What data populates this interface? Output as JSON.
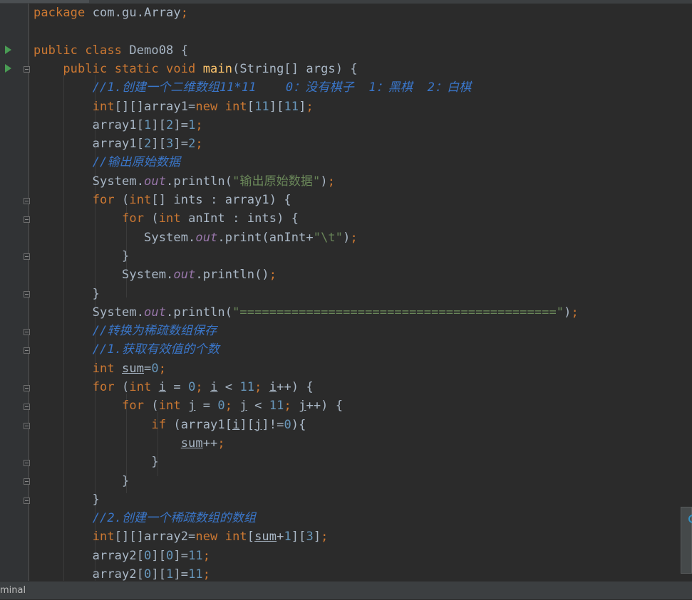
{
  "editor": {
    "lines": [
      [
        [
          "kw",
          "package "
        ],
        [
          "t",
          "com.gu.Array"
        ],
        [
          "kw",
          ";"
        ]
      ],
      [],
      [
        [
          "kw",
          "public class "
        ],
        [
          "t",
          "Demo08 {"
        ]
      ],
      [
        [
          "t",
          "    "
        ],
        [
          "kw",
          "public static void "
        ],
        [
          "fn",
          "main"
        ],
        [
          "t",
          "(String[] args) {"
        ]
      ],
      [
        [
          "t",
          "        "
        ],
        [
          "com",
          "//1.创建一个二维数组11*11    0：没有棋子  1：黑棋  2：白棋"
        ]
      ],
      [
        [
          "t",
          "        "
        ],
        [
          "kw",
          "int"
        ],
        [
          "t",
          "[][]array1="
        ],
        [
          "kw",
          "new int"
        ],
        [
          "t",
          "["
        ],
        [
          "num",
          "11"
        ],
        [
          "t",
          "]["
        ],
        [
          "num",
          "11"
        ],
        [
          "t",
          "]"
        ],
        [
          "kw",
          ";"
        ]
      ],
      [
        [
          "t",
          "        array1["
        ],
        [
          "num",
          "1"
        ],
        [
          "t",
          "]["
        ],
        [
          "num",
          "2"
        ],
        [
          "t",
          "]="
        ],
        [
          "num",
          "1"
        ],
        [
          "kw",
          ";"
        ]
      ],
      [
        [
          "t",
          "        array1["
        ],
        [
          "num",
          "2"
        ],
        [
          "t",
          "]["
        ],
        [
          "num",
          "3"
        ],
        [
          "t",
          "]="
        ],
        [
          "num",
          "2"
        ],
        [
          "kw",
          ";"
        ]
      ],
      [
        [
          "t",
          "        "
        ],
        [
          "com",
          "//输出原始数据"
        ]
      ],
      [
        [
          "t",
          "        System."
        ],
        [
          "fld",
          "out"
        ],
        [
          "t",
          ".println("
        ],
        [
          "str",
          "\"输出原始数据\""
        ],
        [
          "t",
          ")"
        ],
        [
          "kw",
          ";"
        ]
      ],
      [
        [
          "t",
          "        "
        ],
        [
          "kw",
          "for "
        ],
        [
          "t",
          "("
        ],
        [
          "kw",
          "int"
        ],
        [
          "t",
          "[] ints : array1) {"
        ]
      ],
      [
        [
          "t",
          "            "
        ],
        [
          "kw",
          "for "
        ],
        [
          "t",
          "("
        ],
        [
          "kw",
          "int "
        ],
        [
          "t",
          "anInt : ints) {"
        ]
      ],
      [
        [
          "t",
          "               System."
        ],
        [
          "fld",
          "out"
        ],
        [
          "t",
          ".print(anInt+"
        ],
        [
          "str",
          "\"\\t\""
        ],
        [
          "t",
          ")"
        ],
        [
          "kw",
          ";"
        ]
      ],
      [
        [
          "t",
          "            }"
        ]
      ],
      [
        [
          "t",
          "            System."
        ],
        [
          "fld",
          "out"
        ],
        [
          "t",
          ".println()"
        ],
        [
          "kw",
          ";"
        ]
      ],
      [
        [
          "t",
          "        }"
        ]
      ],
      [
        [
          "t",
          "        System."
        ],
        [
          "fld",
          "out"
        ],
        [
          "t",
          ".println("
        ],
        [
          "str",
          "\"===========================================\""
        ],
        [
          "t",
          ")"
        ],
        [
          "kw",
          ";"
        ]
      ],
      [
        [
          "t",
          "        "
        ],
        [
          "com",
          "//转换为稀疏数组保存"
        ]
      ],
      [
        [
          "t",
          "        "
        ],
        [
          "com",
          "//1.获取有效值的个数"
        ]
      ],
      [
        [
          "t",
          "        "
        ],
        [
          "kw",
          "int "
        ],
        [
          "ul",
          "sum"
        ],
        [
          "t",
          "="
        ],
        [
          "num",
          "0"
        ],
        [
          "kw",
          ";"
        ]
      ],
      [
        [
          "t",
          "        "
        ],
        [
          "kw",
          "for "
        ],
        [
          "t",
          "("
        ],
        [
          "kw",
          "int "
        ],
        [
          "ul",
          "i"
        ],
        [
          "t",
          " = "
        ],
        [
          "num",
          "0"
        ],
        [
          "kw",
          "; "
        ],
        [
          "ul",
          "i"
        ],
        [
          "t",
          " < "
        ],
        [
          "num",
          "11"
        ],
        [
          "kw",
          "; "
        ],
        [
          "ul",
          "i"
        ],
        [
          "t",
          "++) {"
        ]
      ],
      [
        [
          "t",
          "            "
        ],
        [
          "kw",
          "for "
        ],
        [
          "t",
          "("
        ],
        [
          "kw",
          "int "
        ],
        [
          "ul",
          "j"
        ],
        [
          "t",
          " = "
        ],
        [
          "num",
          "0"
        ],
        [
          "kw",
          "; "
        ],
        [
          "ul",
          "j"
        ],
        [
          "t",
          " < "
        ],
        [
          "num",
          "11"
        ],
        [
          "kw",
          "; "
        ],
        [
          "ul",
          "j"
        ],
        [
          "t",
          "++) {"
        ]
      ],
      [
        [
          "t",
          "                "
        ],
        [
          "kw",
          "if "
        ],
        [
          "t",
          "(array1["
        ],
        [
          "ul",
          "i"
        ],
        [
          "t",
          "]["
        ],
        [
          "ul",
          "j"
        ],
        [
          "t",
          "]!="
        ],
        [
          "num",
          "0"
        ],
        [
          "t",
          "){"
        ]
      ],
      [
        [
          "t",
          "                    "
        ],
        [
          "ul",
          "sum"
        ],
        [
          "t",
          "++"
        ],
        [
          "kw",
          ";"
        ]
      ],
      [
        [
          "t",
          "                }"
        ]
      ],
      [
        [
          "t",
          "            }"
        ]
      ],
      [
        [
          "t",
          "        }"
        ]
      ],
      [
        [
          "t",
          "        "
        ],
        [
          "com",
          "//2.创建一个稀疏数组的数组"
        ]
      ],
      [
        [
          "t",
          "        "
        ],
        [
          "kw",
          "int"
        ],
        [
          "t",
          "[][]array2="
        ],
        [
          "kw",
          "new int"
        ],
        [
          "t",
          "["
        ],
        [
          "ul",
          "sum"
        ],
        [
          "t",
          "+"
        ],
        [
          "num",
          "1"
        ],
        [
          "t",
          "]["
        ],
        [
          "num",
          "3"
        ],
        [
          "t",
          "]"
        ],
        [
          "kw",
          ";"
        ]
      ],
      [
        [
          "t",
          "        array2["
        ],
        [
          "num",
          "0"
        ],
        [
          "t",
          "]["
        ],
        [
          "num",
          "0"
        ],
        [
          "t",
          "]="
        ],
        [
          "num",
          "11"
        ],
        [
          "kw",
          ";"
        ]
      ],
      [
        [
          "t",
          "        array2["
        ],
        [
          "num",
          "0"
        ],
        [
          "t",
          "]["
        ],
        [
          "num",
          "1"
        ],
        [
          "t",
          "]="
        ],
        [
          "num",
          "11"
        ],
        [
          "kw",
          ";"
        ]
      ]
    ]
  },
  "status": {
    "terminal_label": "minal"
  },
  "icons": {
    "run": "run-icon",
    "fold": "fold-icon",
    "popup": "notification-icon"
  }
}
